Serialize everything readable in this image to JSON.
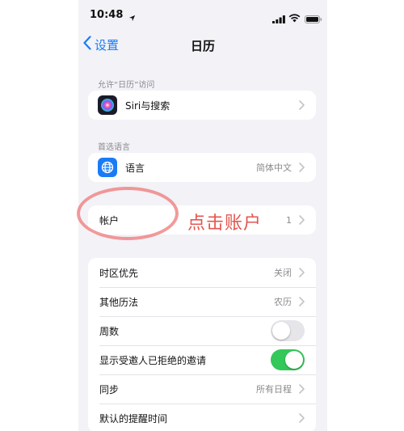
{
  "status_bar": {
    "time": "10:48"
  },
  "nav": {
    "back_label": "设置",
    "title": "日历"
  },
  "sections": {
    "allow_access": {
      "header": "允许“日历”访问",
      "siri": {
        "label": "Siri与搜索"
      }
    },
    "preferred_language": {
      "header": "首选语言",
      "language": {
        "label": "语言",
        "value": "简体中文"
      }
    },
    "accounts": {
      "label": "帐户",
      "value": "1"
    },
    "settings": {
      "timezone": {
        "label": "时区优先",
        "value": "关闭"
      },
      "alt_calendar": {
        "label": "其他历法",
        "value": "农历"
      },
      "week_numbers": {
        "label": "周数",
        "on": false
      },
      "show_declined": {
        "label": "显示受邀人已拒绝的邀请",
        "on": true
      },
      "sync": {
        "label": "同步",
        "value": "所有日程"
      },
      "default_alert": {
        "label": "默认的提醒时间"
      }
    }
  },
  "annotation": {
    "text": "点击账户"
  },
  "colors": {
    "accent": "#1a7cf5",
    "toggle_on": "#34c759",
    "toggle_off": "#e5e5ea",
    "annotation": "#e5554f"
  }
}
